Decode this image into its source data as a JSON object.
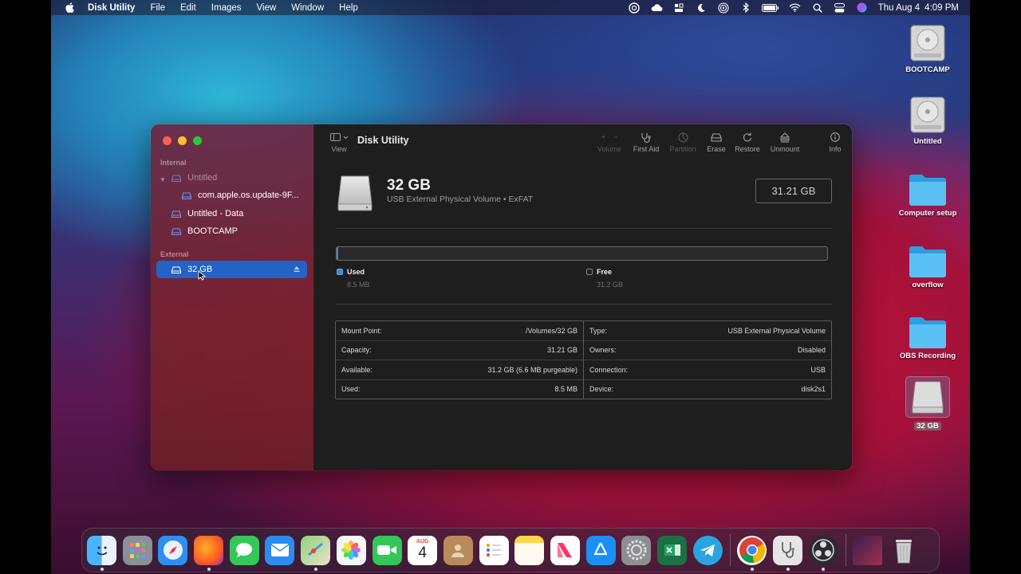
{
  "menubar": {
    "app_name": "Disk Utility",
    "items": [
      "File",
      "Edit",
      "Images",
      "View",
      "Window",
      "Help"
    ],
    "status_icons": [
      "creative-cloud-icon",
      "icloud-icon",
      "stage-icon",
      "focus-moon-icon",
      "airdrop-icon",
      "bluetooth-icon",
      "battery-icon",
      "wifi-icon",
      "search-icon",
      "control-center-icon",
      "siri-icon"
    ],
    "clock_day": "Thu Aug 4",
    "clock_time": "4:09 PM"
  },
  "window": {
    "title": "Disk Utility",
    "view_label": "View",
    "toolbar": {
      "volume": "Volume",
      "first_aid": "First Aid",
      "partition": "Partition",
      "erase": "Erase",
      "restore": "Restore",
      "unmount": "Unmount",
      "info": "Info"
    },
    "sidebar": {
      "internal_header": "Internal",
      "external_header": "External",
      "internal_items": [
        {
          "label": "Untitled"
        },
        {
          "label": "com.apple.os.update-9F..."
        },
        {
          "label": "Untitled - Data"
        },
        {
          "label": "BOOTCAMP"
        }
      ],
      "external_items": [
        {
          "label": "32 GB"
        }
      ]
    },
    "volume": {
      "name": "32 GB",
      "description": "USB External Physical Volume • ExFAT",
      "capacity_badge": "31.21 GB",
      "used_fraction": 0.0003,
      "used_label": "Used",
      "used_value": "8.5 MB",
      "free_label": "Free",
      "free_value": "31.2 GB",
      "used_color": "#3a8ad6"
    },
    "info": {
      "left": [
        {
          "key": "Mount Point:",
          "value": "/Volumes/32 GB"
        },
        {
          "key": "Capacity:",
          "value": "31.21 GB"
        },
        {
          "key": "Available:",
          "value": "31.2 GB (6.6 MB purgeable)"
        },
        {
          "key": "Used:",
          "value": "8.5 MB"
        }
      ],
      "right": [
        {
          "key": "Type:",
          "value": "USB External Physical Volume"
        },
        {
          "key": "Owners:",
          "value": "Disabled"
        },
        {
          "key": "Connection:",
          "value": "USB"
        },
        {
          "key": "Device:",
          "value": "disk2s1"
        }
      ]
    }
  },
  "desktop": {
    "items": [
      {
        "label": "BOOTCAMP",
        "icon": "hard-drive-icon"
      },
      {
        "label": "Untitled",
        "icon": "hard-drive-icon"
      },
      {
        "label": "Computer setup",
        "icon": "folder-icon"
      },
      {
        "label": "overflow",
        "icon": "folder-icon"
      },
      {
        "label": "OBS Recording",
        "icon": "folder-icon"
      },
      {
        "label": "32 GB",
        "icon": "external-drive-icon"
      }
    ]
  },
  "dock": {
    "calendar_month": "AUG",
    "calendar_day": "4",
    "apps": [
      "finder",
      "launchpad",
      "safari",
      "firefox",
      "messages",
      "mail",
      "maps",
      "photos",
      "facetime",
      "calendar",
      "contacts",
      "reminders",
      "notes",
      "news",
      "app-store",
      "system-preferences",
      "excel",
      "telegram",
      "chrome",
      "disk-utility",
      "obs",
      "recent-window",
      "trash"
    ]
  }
}
